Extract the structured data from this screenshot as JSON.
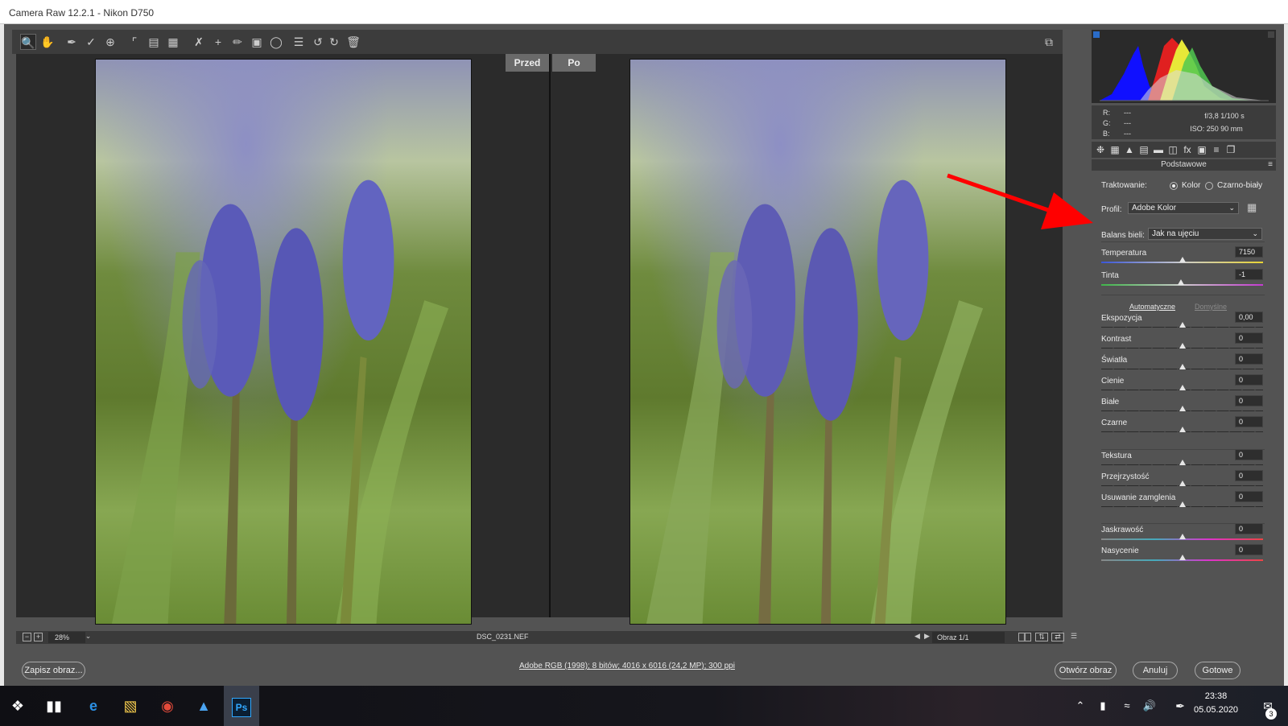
{
  "window": {
    "title": "Camera Raw 12.2.1  -  Nikon D750"
  },
  "toolbar": {
    "tools": [
      "zoom-icon",
      "hand-icon",
      "white-balance-icon",
      "color-sampler-icon",
      "target-adjust-icon",
      "crop-icon",
      "straighten-icon",
      "transform-icon",
      "spot-removal-icon",
      "red-eye-icon",
      "adjustment-brush-icon",
      "graduated-filter-icon",
      "radial-filter-icon",
      "presets-list-icon",
      "rotate-left-icon",
      "rotate-right-icon",
      "trash-icon"
    ]
  },
  "compare": {
    "before_label": "Przed",
    "after_label": "Po"
  },
  "preview_status": {
    "zoom": "28%",
    "filename": "DSC_0231.NEF",
    "image_counter": "Obraz 1/1"
  },
  "footer": {
    "save_label": "Zapisz obraz...",
    "info_link": "Adobe RGB (1998); 8 bitów; 4016 x 6016 (24,2 MP); 300 ppi",
    "open_label": "Otwórz obraz",
    "cancel_label": "Anuluj",
    "done_label": "Gotowe"
  },
  "exif": {
    "r_label": "R:",
    "g_label": "G:",
    "b_label": "B:",
    "r_value": "---",
    "g_value": "---",
    "b_value": "---",
    "aperture_shutter": "f/3,8   1/100 s",
    "iso_focal": "ISO: 250   90 mm"
  },
  "panel": {
    "section_title": "Podstawowe",
    "treatment_label": "Traktowanie:",
    "treatment_color": "Kolor",
    "treatment_bw": "Czarno-biały",
    "profile_label": "Profil:",
    "profile_value": "Adobe Kolor",
    "wb_label": "Balans bieli:",
    "wb_value": "Jak na ujęciu",
    "auto_label": "Automatyczne",
    "default_label": "Domyślne",
    "sliders": [
      {
        "label": "Temperatura",
        "value": "7150",
        "position": 0.5
      },
      {
        "label": "Tinta",
        "value": "-1",
        "position": 0.495
      },
      {
        "label": "Ekspozycja",
        "value": "0,00",
        "position": 0.5
      },
      {
        "label": "Kontrast",
        "value": "0",
        "position": 0.5
      },
      {
        "label": "Światła",
        "value": "0",
        "position": 0.5
      },
      {
        "label": "Cienie",
        "value": "0",
        "position": 0.5
      },
      {
        "label": "Białe",
        "value": "0",
        "position": 0.5
      },
      {
        "label": "Czarne",
        "value": "0",
        "position": 0.5
      },
      {
        "label": "Tekstura",
        "value": "0",
        "position": 0.5
      },
      {
        "label": "Przejrzystość",
        "value": "0",
        "position": 0.5
      },
      {
        "label": "Usuwanie zamglenia",
        "value": "0",
        "position": 0.5
      },
      {
        "label": "Jaskrawość",
        "value": "0",
        "position": 0.5
      },
      {
        "label": "Nasycenie",
        "value": "0",
        "position": 0.5
      }
    ]
  },
  "taskbar": {
    "time": "23:38",
    "date": "05.05.2020",
    "notification_count": "3"
  },
  "colors": {
    "annotation_arrow": "#ff0000",
    "accent": "#2a6cc8"
  }
}
